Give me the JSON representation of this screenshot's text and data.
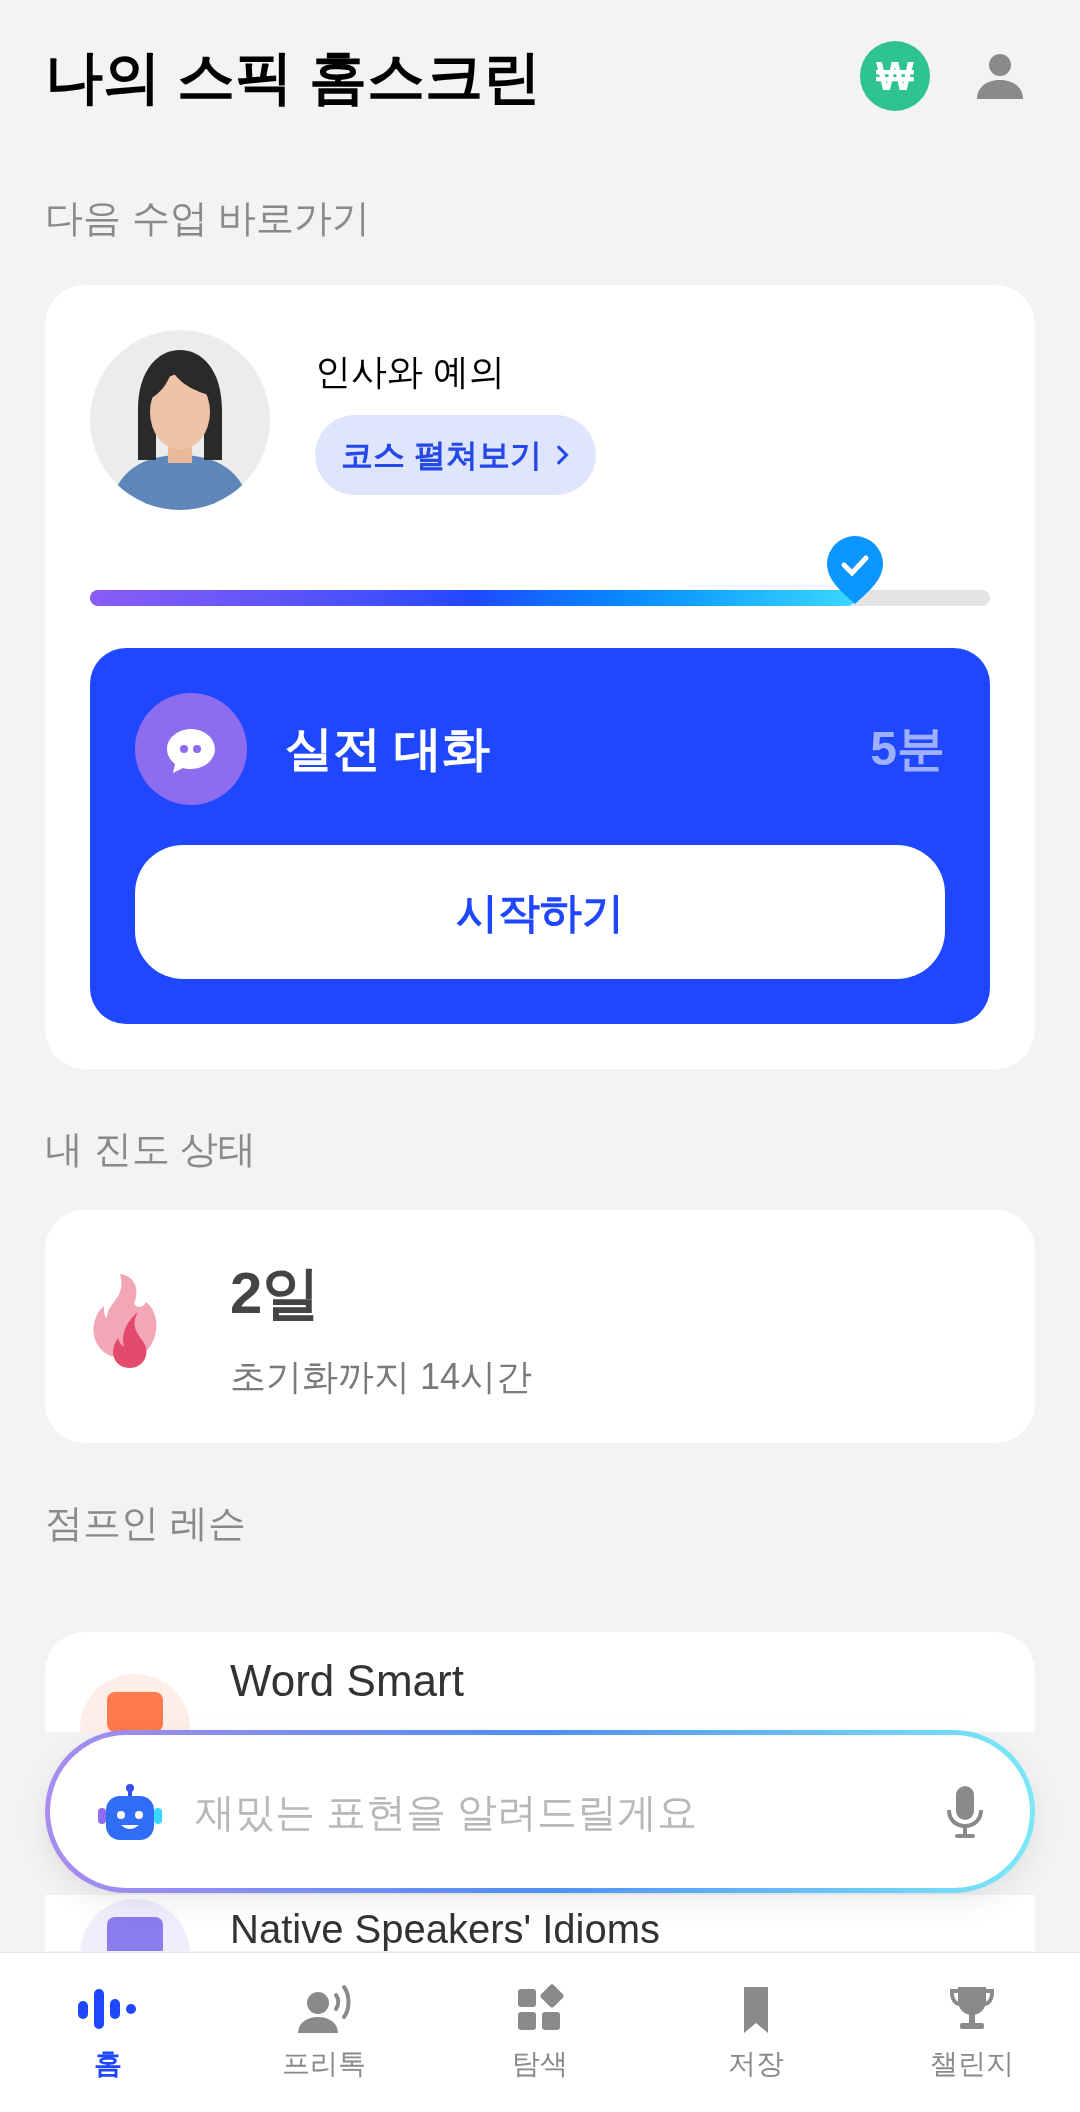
{
  "header": {
    "title": "나의 스픽 홈스크린",
    "coin_label": "₩"
  },
  "next_lesson": {
    "section_title": "다음 수업 바로가기",
    "course_title": "인사와 예의",
    "course_button": "코스 펼쳐보기",
    "progress": {
      "level": 0.85
    },
    "activity": {
      "title": "실전 대화",
      "duration": "5분",
      "start_button": "시작하기"
    }
  },
  "streak": {
    "section_title": "내 진도 상태",
    "days": "2일",
    "reset_note": "초기화까지 14시간"
  },
  "jump_in": {
    "section_title": "점프인 레슨",
    "lessons": [
      {
        "title": "Word Smart",
        "color": "#ff7a4d"
      },
      {
        "title": "Native Speakers' Idioms",
        "color": "#8b7cf0"
      }
    ]
  },
  "assistant": {
    "placeholder": "재밌는 표현을 알려드릴게요"
  },
  "nav": [
    {
      "kind": "home",
      "label": "홈",
      "selected": true
    },
    {
      "kind": "freetalk",
      "label": "프리톡",
      "selected": false
    },
    {
      "kind": "explore",
      "label": "탐색",
      "selected": false
    },
    {
      "kind": "saved",
      "label": "저장",
      "selected": false
    },
    {
      "kind": "challenge",
      "label": "챌린지",
      "selected": false
    }
  ]
}
